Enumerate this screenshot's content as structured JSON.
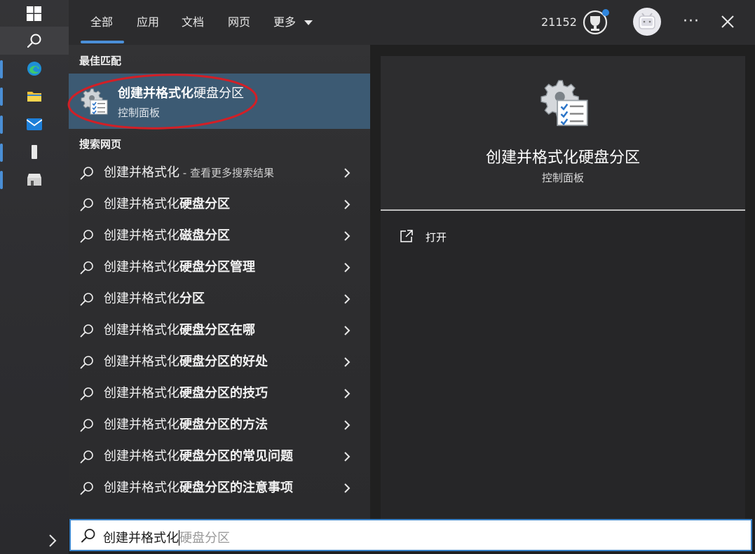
{
  "tabs": {
    "all": "全部",
    "apps": "应用",
    "docs": "文档",
    "web": "网页",
    "more": "更多"
  },
  "header": {
    "points": "21152",
    "more_label": "···"
  },
  "best_match": {
    "section_title": "最佳匹配",
    "title_bold": "创建并格式化",
    "title_rest": "硬盘分区",
    "subtitle": "控制面板"
  },
  "web_search": {
    "section_title": "搜索网页",
    "prefix": "创建并格式化",
    "first_hint": " - 查看更多搜索结果",
    "items": [
      "",
      "硬盘分区",
      "磁盘分区",
      "硬盘分区管理",
      "分区",
      "硬盘分区在哪",
      "硬盘分区的好处",
      "硬盘分区的技巧",
      "硬盘分区的方法",
      "硬盘分区的常见问题",
      "硬盘分区的注意事项"
    ]
  },
  "preview": {
    "title": "创建并格式化硬盘分区",
    "subtitle": "控制面板",
    "open_label": "打开"
  },
  "search": {
    "typed": "创建并格式化",
    "suggestion": "硬盘分区"
  },
  "colors": {
    "selected_bg": "#3c5a73",
    "accent": "#4b8fd8",
    "annotation_red": "#d21f26"
  }
}
